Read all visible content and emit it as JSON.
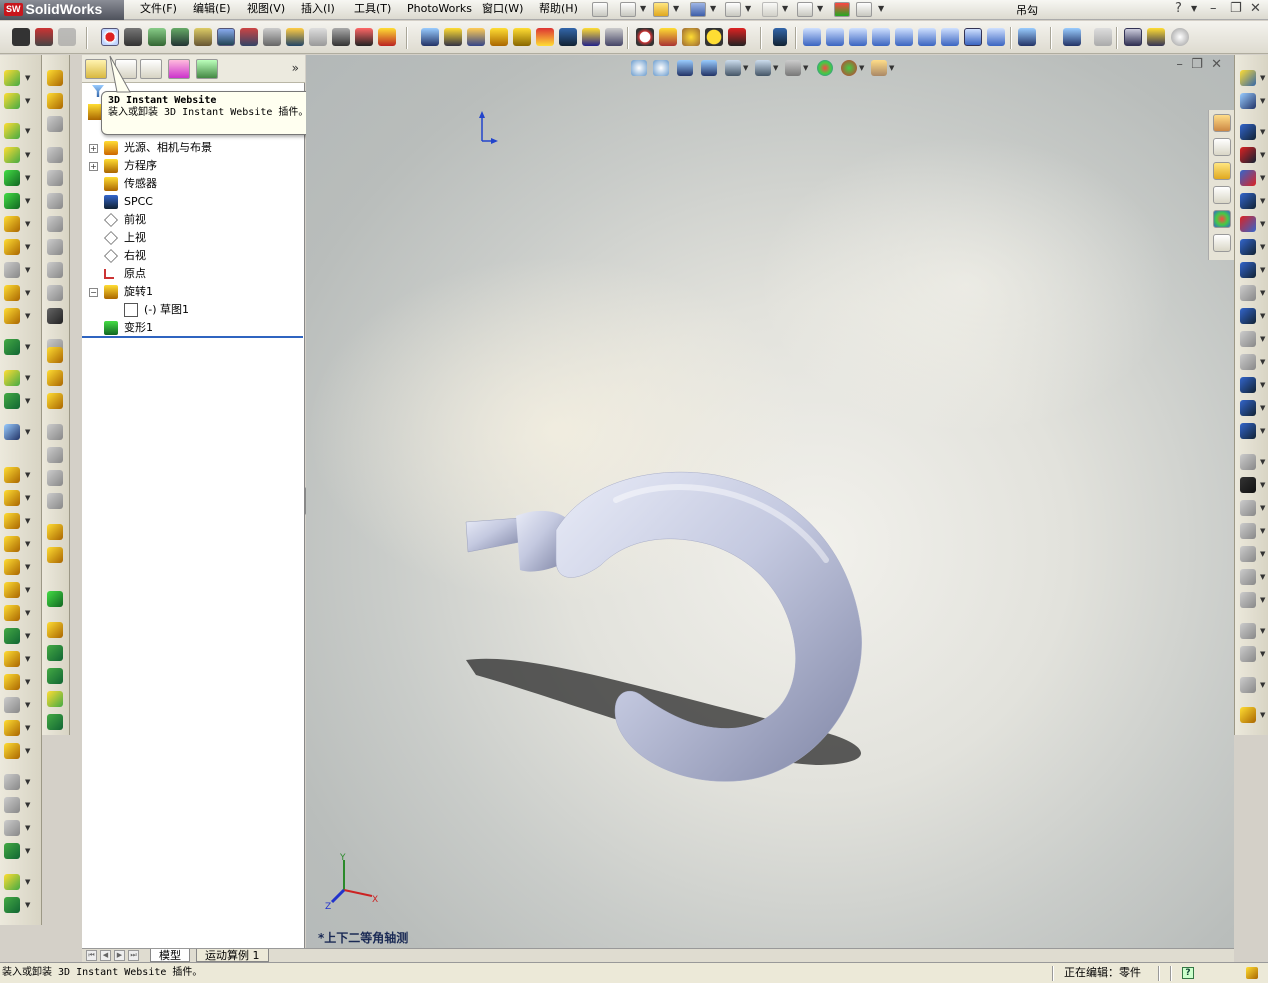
{
  "app": {
    "name": "SolidWorks",
    "logo_badge": "SW",
    "document_title": "吊勾"
  },
  "menu": {
    "items": [
      "文件(F)",
      "编辑(E)",
      "视图(V)",
      "插入(I)",
      "工具(T)",
      "PhotoWorks",
      "窗口(W)",
      "帮助(H)"
    ]
  },
  "tooltip": {
    "title": "3D Instant Website",
    "body": "装入或卸装 3D Instant Website 插件。"
  },
  "feature_tree": {
    "items": [
      {
        "label": "光源、相机与布景",
        "icon": "lights-cameras-icon",
        "expand": "+"
      },
      {
        "label": "方程序",
        "icon": "equations-icon",
        "expand": "+"
      },
      {
        "label": "传感器",
        "icon": "sensors-icon",
        "expand": ""
      },
      {
        "label": "SPCC",
        "icon": "material-icon",
        "expand": ""
      },
      {
        "label": "前视",
        "icon": "plane-icon",
        "expand": ""
      },
      {
        "label": "上视",
        "icon": "plane-icon",
        "expand": ""
      },
      {
        "label": "右视",
        "icon": "plane-icon",
        "expand": ""
      },
      {
        "label": "原点",
        "icon": "origin-icon",
        "expand": ""
      },
      {
        "label": "旋转1",
        "icon": "revolve-icon",
        "expand": "−"
      },
      {
        "label": "(-) 草图1",
        "icon": "sketch-icon",
        "expand": ""
      },
      {
        "label": "变形1",
        "icon": "deform-icon",
        "expand": ""
      }
    ]
  },
  "viewport": {
    "view_name": "*上下二等角轴测",
    "triad": {
      "x": "X",
      "y": "Y",
      "z": "Z"
    }
  },
  "bottom_tabs": [
    "模型",
    "运动算例 1"
  ],
  "status": {
    "message": "装入或卸装 3D Instant Website 插件。",
    "editing": "正在编辑：零件",
    "help_icon": "?"
  },
  "colors": {
    "accent": "#2f64c0",
    "logo_red": "#c8161d",
    "model": "#b8bdd6"
  }
}
